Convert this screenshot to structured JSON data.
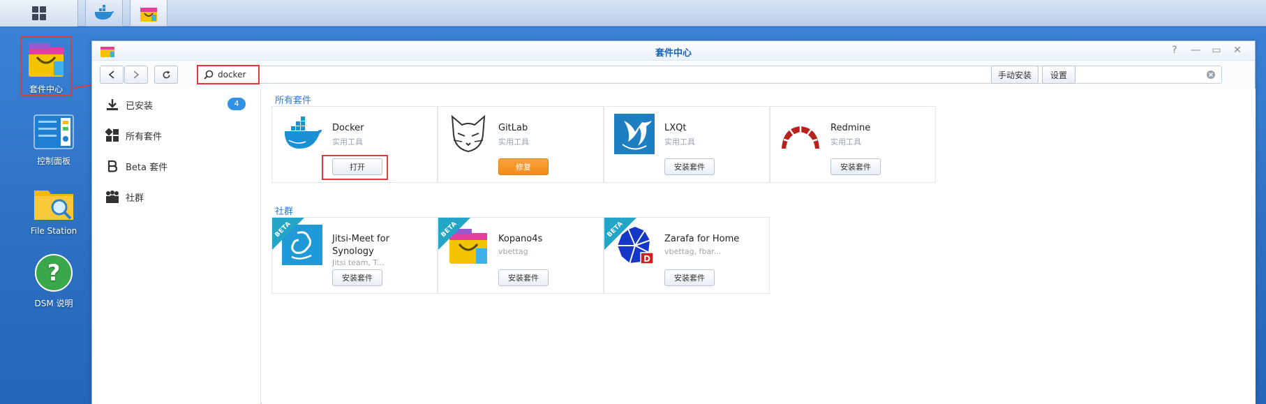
{
  "taskbar": {
    "items": [
      "main-menu",
      "docker",
      "package-center"
    ]
  },
  "desktop": {
    "icons": [
      {
        "label": "套件中心"
      },
      {
        "label": "控制面板"
      },
      {
        "label": "File Station"
      },
      {
        "label": "DSM 说明"
      }
    ]
  },
  "window": {
    "title": "套件中心",
    "controls": [
      "?",
      "—",
      "▭",
      "✕"
    ]
  },
  "toolbar": {
    "search_value": "docker",
    "manual_install_label": "手动安装",
    "settings_label": "设置"
  },
  "sidebar": {
    "items": [
      {
        "label": "已安装",
        "badge": "4"
      },
      {
        "label": "所有套件"
      },
      {
        "label": "Beta 套件"
      },
      {
        "label": "社群"
      }
    ]
  },
  "sections": {
    "all_packages": {
      "title": "所有套件",
      "cards": [
        {
          "name": "Docker",
          "sub": "实用工具",
          "action": "打开"
        },
        {
          "name": "GitLab",
          "sub": "实用工具",
          "action": "修复"
        },
        {
          "name": "LXQt",
          "sub": "实用工具",
          "action": "安装套件"
        },
        {
          "name": "Redmine",
          "sub": "实用工具",
          "action": "安装套件"
        }
      ]
    },
    "community": {
      "title": "社群",
      "cards": [
        {
          "name": "Jitsi-Meet for Synology",
          "sub": "Jitsi team, T...",
          "action": "安装套件",
          "ribbon": "BETA"
        },
        {
          "name": "Kopano4s",
          "sub": "vbettag",
          "action": "安装套件",
          "ribbon": "BETA"
        },
        {
          "name": "Zarafa for Home",
          "sub": "vbettag, fbar...",
          "action": "安装套件",
          "ribbon": "BETA"
        }
      ]
    }
  },
  "colors": {
    "accent": "#2f7bd6",
    "repair": "#f08a18",
    "highlight": "#e23a3a",
    "desktop": "#2c6fc2"
  }
}
